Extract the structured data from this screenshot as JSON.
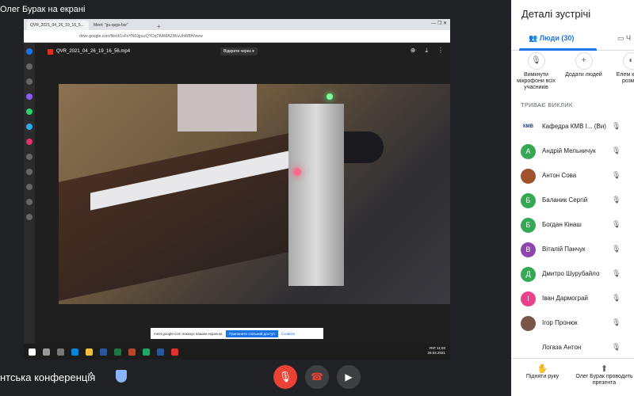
{
  "presenter_label": "Олег Бурак на екрані",
  "browser": {
    "tabs": [
      "QVR_2021_04_26_19_16_5...",
      "Meet: \"gu-qsgs-bsr\""
    ],
    "address": "drive.google.com/file/d/1xFoYN03jpszQYDqTKAMAZiWuUhWBH/view",
    "window_controls": "—  ❐  ✕"
  },
  "player": {
    "file_name": "QVR_2021_04_26_19_16_56.mp4",
    "open_with": "Відкрити через ▾",
    "actions": [
      "⊕",
      "⤓",
      "⋮"
    ]
  },
  "share_notice": {
    "text": "meet.google.com показує вашим екраном.",
    "stop": "Припинити спільний доступ",
    "hide": "Сховати"
  },
  "taskbar": {
    "lang": "УКР",
    "time": "11:02",
    "date": "29.04.2021"
  },
  "bottom_bar": {
    "meeting_name": "нтська конференція",
    "chevron": "^"
  },
  "panel": {
    "title": "Деталі зустрічі",
    "people_tab": "Люди (30)",
    "chat_tab": "Ч",
    "actions": [
      {
        "label": "Вимкнути мікрофони всіх учасників"
      },
      {
        "label": "Додати людей"
      },
      {
        "label": "Елем керув розміщ"
      }
    ],
    "section_title": "ТРИВАЄ ВИКЛИК",
    "participants": [
      {
        "name": "Кафедра КМВ І... (Ви)",
        "initial": "КМВ",
        "color": "#ffffff"
      },
      {
        "name": "Андрій Мельничук",
        "initial": "А",
        "color": "#34a853"
      },
      {
        "name": "Антон Сова",
        "initial": "",
        "color": "#a0522d"
      },
      {
        "name": "Баланик Сергій",
        "initial": "Б",
        "color": "#34a853"
      },
      {
        "name": "Богдан Кінаш",
        "initial": "Б",
        "color": "#34a853"
      },
      {
        "name": "Віталій Панчук",
        "initial": "В",
        "color": "#8e44ad"
      },
      {
        "name": "Дмитро Шурубайло",
        "initial": "Д",
        "color": "#34a853"
      },
      {
        "name": "Іван Дармограй",
        "initial": "І",
        "color": "#e8438a"
      },
      {
        "name": "Ігор Пронюк",
        "initial": "",
        "color": "#795548"
      },
      {
        "name": "Логаза Антон",
        "initial": "",
        "color": "#ffffff"
      }
    ],
    "bottom_actions": [
      {
        "label": "Підняти руку"
      },
      {
        "label": "Олег Бурак проводить презента"
      }
    ]
  }
}
